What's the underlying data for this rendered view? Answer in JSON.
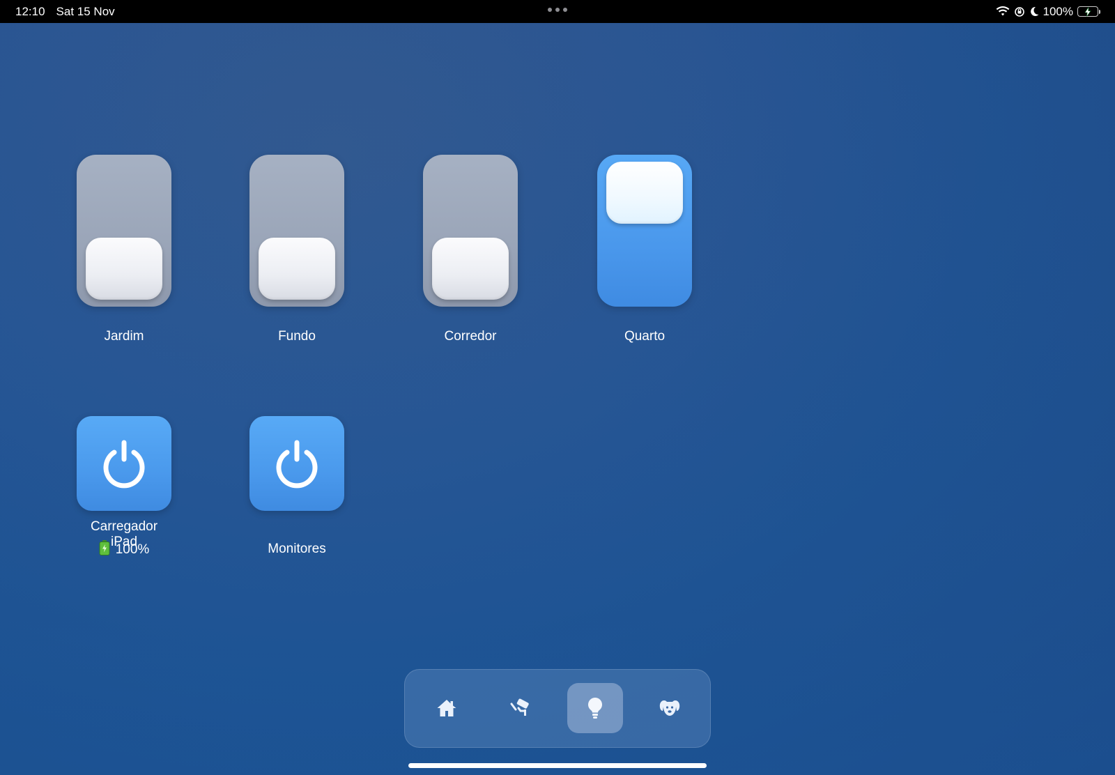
{
  "statusbar": {
    "time": "12:10",
    "date": "Sat 15 Nov",
    "battery_pct": "100%"
  },
  "switches": [
    {
      "label": "Jardim",
      "state": "off"
    },
    {
      "label": "Fundo",
      "state": "off"
    },
    {
      "label": "Corredor",
      "state": "off"
    },
    {
      "label": "Quarto",
      "state": "on"
    }
  ],
  "power": [
    {
      "label": "Carregador iPad",
      "battery": "100%",
      "state": "on"
    },
    {
      "label": "Monitores",
      "state": "on"
    }
  ],
  "dock": {
    "items": [
      {
        "icon": "home-icon"
      },
      {
        "icon": "security-camera-icon"
      },
      {
        "icon": "lightbulb-icon",
        "active": true
      },
      {
        "icon": "dog-icon"
      }
    ]
  },
  "colors": {
    "accent_blue": "#4a99ec",
    "switch_off": "#9aa5b8",
    "background": "#2a5592"
  }
}
